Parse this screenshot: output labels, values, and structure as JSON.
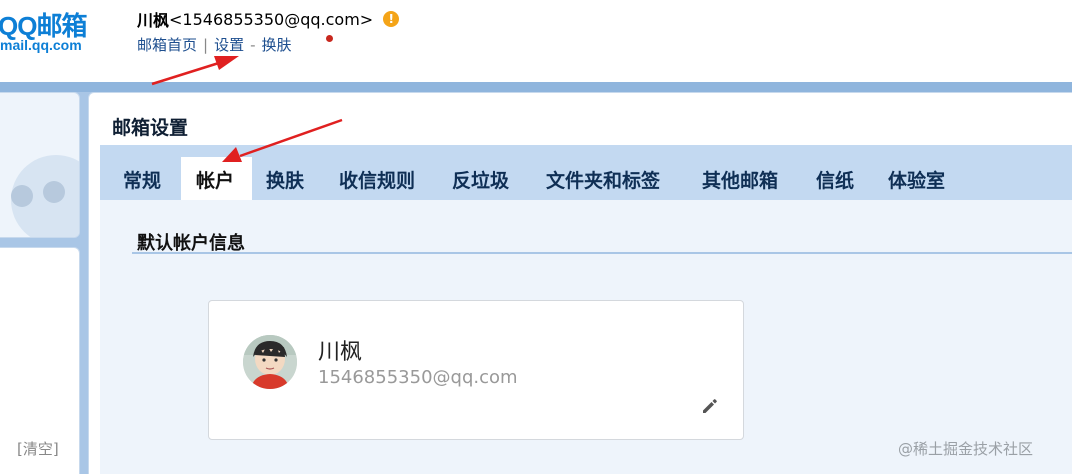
{
  "header": {
    "logo_text": "QQ邮箱",
    "logo_sub": "mail.qq.com",
    "user_name": "川枫",
    "user_email": "<1546855350@qq.com>",
    "warning_glyph": "!",
    "nav": {
      "home": "邮箱首页",
      "sep1": "|",
      "settings": "设置",
      "sep2": "-",
      "skin": "换肤"
    }
  },
  "sidebar": {
    "clear_label": "[清空]"
  },
  "settings": {
    "title": "邮箱设置",
    "tabs": [
      {
        "label": "常规",
        "active": false
      },
      {
        "label": "帐户",
        "active": true
      },
      {
        "label": "换肤",
        "active": false
      },
      {
        "label": "收信规则",
        "active": false
      },
      {
        "label": "反垃圾",
        "active": false
      },
      {
        "label": "文件夹和标签",
        "active": false
      },
      {
        "label": "其他邮箱",
        "active": false
      },
      {
        "label": "信纸",
        "active": false
      },
      {
        "label": "体验室",
        "active": false
      }
    ]
  },
  "account": {
    "section_title": "默认帐户信息",
    "name": "川枫",
    "email": "1546855350@qq.com"
  },
  "watermark": "@稀土掘金技术社区",
  "colors": {
    "brand_blue": "#0d7fd6",
    "frame_blue": "#a9c6e6",
    "tab_bar": "#c3d9f1",
    "annotation_red": "#e02020",
    "notification_dot": "#c8281e"
  },
  "icons": [
    "warning-icon",
    "pencil-icon",
    "avatar-image"
  ]
}
